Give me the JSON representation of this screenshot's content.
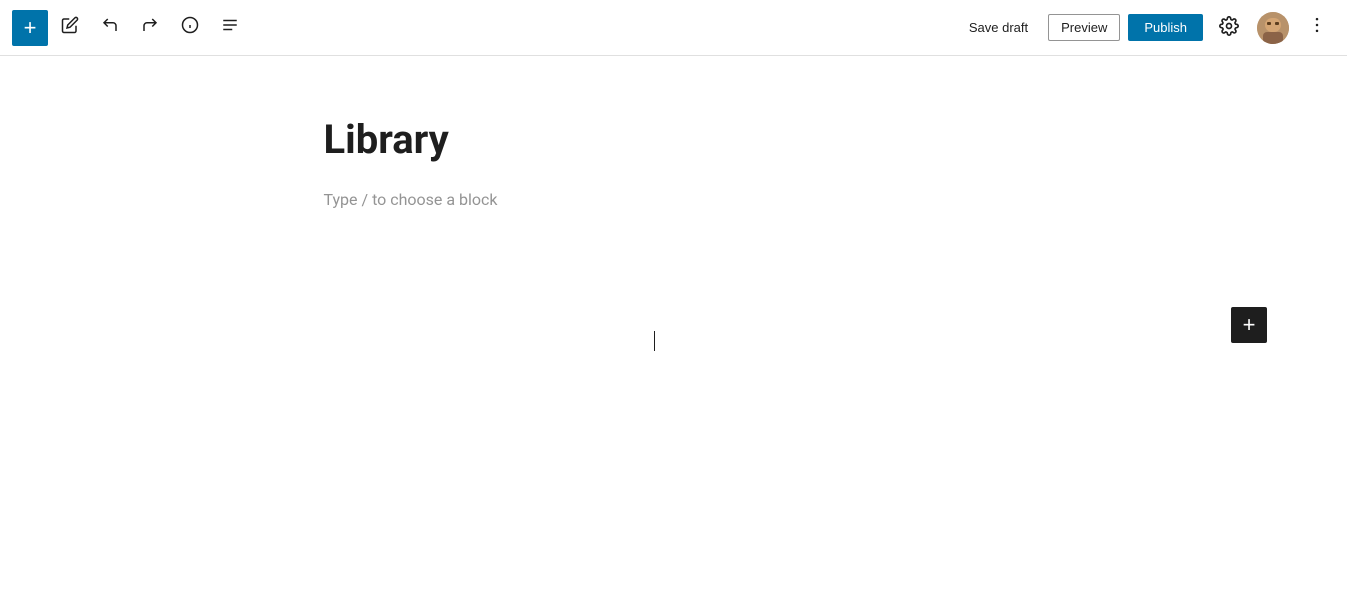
{
  "toolbar": {
    "add_label": "+",
    "save_draft_label": "Save draft",
    "preview_label": "Preview",
    "publish_label": "Publish"
  },
  "editor": {
    "post_title": "Library",
    "block_placeholder": "Type / to choose a block"
  },
  "icons": {
    "add": "+",
    "edit": "✏",
    "undo": "↩",
    "redo": "↪",
    "info": "ⓘ",
    "list": "☰",
    "gear": "⚙",
    "more": "⋮",
    "add_block": "+"
  },
  "colors": {
    "primary": "#0073aa",
    "toolbar_bg": "#ffffff",
    "border": "#e0e0e0",
    "text": "#1e1e1e",
    "placeholder": "#949494"
  }
}
